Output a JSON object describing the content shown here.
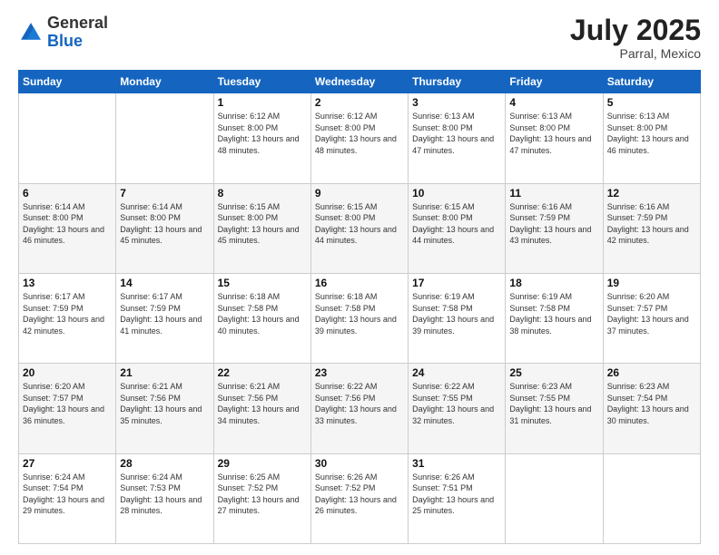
{
  "logo": {
    "general": "General",
    "blue": "Blue"
  },
  "header": {
    "month_year": "July 2025",
    "location": "Parral, Mexico"
  },
  "days_of_week": [
    "Sunday",
    "Monday",
    "Tuesday",
    "Wednesday",
    "Thursday",
    "Friday",
    "Saturday"
  ],
  "weeks": [
    [
      {
        "day": "",
        "sunrise": "",
        "sunset": "",
        "daylight": ""
      },
      {
        "day": "",
        "sunrise": "",
        "sunset": "",
        "daylight": ""
      },
      {
        "day": "1",
        "sunrise": "Sunrise: 6:12 AM",
        "sunset": "Sunset: 8:00 PM",
        "daylight": "Daylight: 13 hours and 48 minutes."
      },
      {
        "day": "2",
        "sunrise": "Sunrise: 6:12 AM",
        "sunset": "Sunset: 8:00 PM",
        "daylight": "Daylight: 13 hours and 48 minutes."
      },
      {
        "day": "3",
        "sunrise": "Sunrise: 6:13 AM",
        "sunset": "Sunset: 8:00 PM",
        "daylight": "Daylight: 13 hours and 47 minutes."
      },
      {
        "day": "4",
        "sunrise": "Sunrise: 6:13 AM",
        "sunset": "Sunset: 8:00 PM",
        "daylight": "Daylight: 13 hours and 47 minutes."
      },
      {
        "day": "5",
        "sunrise": "Sunrise: 6:13 AM",
        "sunset": "Sunset: 8:00 PM",
        "daylight": "Daylight: 13 hours and 46 minutes."
      }
    ],
    [
      {
        "day": "6",
        "sunrise": "Sunrise: 6:14 AM",
        "sunset": "Sunset: 8:00 PM",
        "daylight": "Daylight: 13 hours and 46 minutes."
      },
      {
        "day": "7",
        "sunrise": "Sunrise: 6:14 AM",
        "sunset": "Sunset: 8:00 PM",
        "daylight": "Daylight: 13 hours and 45 minutes."
      },
      {
        "day": "8",
        "sunrise": "Sunrise: 6:15 AM",
        "sunset": "Sunset: 8:00 PM",
        "daylight": "Daylight: 13 hours and 45 minutes."
      },
      {
        "day": "9",
        "sunrise": "Sunrise: 6:15 AM",
        "sunset": "Sunset: 8:00 PM",
        "daylight": "Daylight: 13 hours and 44 minutes."
      },
      {
        "day": "10",
        "sunrise": "Sunrise: 6:15 AM",
        "sunset": "Sunset: 8:00 PM",
        "daylight": "Daylight: 13 hours and 44 minutes."
      },
      {
        "day": "11",
        "sunrise": "Sunrise: 6:16 AM",
        "sunset": "Sunset: 7:59 PM",
        "daylight": "Daylight: 13 hours and 43 minutes."
      },
      {
        "day": "12",
        "sunrise": "Sunrise: 6:16 AM",
        "sunset": "Sunset: 7:59 PM",
        "daylight": "Daylight: 13 hours and 42 minutes."
      }
    ],
    [
      {
        "day": "13",
        "sunrise": "Sunrise: 6:17 AM",
        "sunset": "Sunset: 7:59 PM",
        "daylight": "Daylight: 13 hours and 42 minutes."
      },
      {
        "day": "14",
        "sunrise": "Sunrise: 6:17 AM",
        "sunset": "Sunset: 7:59 PM",
        "daylight": "Daylight: 13 hours and 41 minutes."
      },
      {
        "day": "15",
        "sunrise": "Sunrise: 6:18 AM",
        "sunset": "Sunset: 7:58 PM",
        "daylight": "Daylight: 13 hours and 40 minutes."
      },
      {
        "day": "16",
        "sunrise": "Sunrise: 6:18 AM",
        "sunset": "Sunset: 7:58 PM",
        "daylight": "Daylight: 13 hours and 39 minutes."
      },
      {
        "day": "17",
        "sunrise": "Sunrise: 6:19 AM",
        "sunset": "Sunset: 7:58 PM",
        "daylight": "Daylight: 13 hours and 39 minutes."
      },
      {
        "day": "18",
        "sunrise": "Sunrise: 6:19 AM",
        "sunset": "Sunset: 7:58 PM",
        "daylight": "Daylight: 13 hours and 38 minutes."
      },
      {
        "day": "19",
        "sunrise": "Sunrise: 6:20 AM",
        "sunset": "Sunset: 7:57 PM",
        "daylight": "Daylight: 13 hours and 37 minutes."
      }
    ],
    [
      {
        "day": "20",
        "sunrise": "Sunrise: 6:20 AM",
        "sunset": "Sunset: 7:57 PM",
        "daylight": "Daylight: 13 hours and 36 minutes."
      },
      {
        "day": "21",
        "sunrise": "Sunrise: 6:21 AM",
        "sunset": "Sunset: 7:56 PM",
        "daylight": "Daylight: 13 hours and 35 minutes."
      },
      {
        "day": "22",
        "sunrise": "Sunrise: 6:21 AM",
        "sunset": "Sunset: 7:56 PM",
        "daylight": "Daylight: 13 hours and 34 minutes."
      },
      {
        "day": "23",
        "sunrise": "Sunrise: 6:22 AM",
        "sunset": "Sunset: 7:56 PM",
        "daylight": "Daylight: 13 hours and 33 minutes."
      },
      {
        "day": "24",
        "sunrise": "Sunrise: 6:22 AM",
        "sunset": "Sunset: 7:55 PM",
        "daylight": "Daylight: 13 hours and 32 minutes."
      },
      {
        "day": "25",
        "sunrise": "Sunrise: 6:23 AM",
        "sunset": "Sunset: 7:55 PM",
        "daylight": "Daylight: 13 hours and 31 minutes."
      },
      {
        "day": "26",
        "sunrise": "Sunrise: 6:23 AM",
        "sunset": "Sunset: 7:54 PM",
        "daylight": "Daylight: 13 hours and 30 minutes."
      }
    ],
    [
      {
        "day": "27",
        "sunrise": "Sunrise: 6:24 AM",
        "sunset": "Sunset: 7:54 PM",
        "daylight": "Daylight: 13 hours and 29 minutes."
      },
      {
        "day": "28",
        "sunrise": "Sunrise: 6:24 AM",
        "sunset": "Sunset: 7:53 PM",
        "daylight": "Daylight: 13 hours and 28 minutes."
      },
      {
        "day": "29",
        "sunrise": "Sunrise: 6:25 AM",
        "sunset": "Sunset: 7:52 PM",
        "daylight": "Daylight: 13 hours and 27 minutes."
      },
      {
        "day": "30",
        "sunrise": "Sunrise: 6:26 AM",
        "sunset": "Sunset: 7:52 PM",
        "daylight": "Daylight: 13 hours and 26 minutes."
      },
      {
        "day": "31",
        "sunrise": "Sunrise: 6:26 AM",
        "sunset": "Sunset: 7:51 PM",
        "daylight": "Daylight: 13 hours and 25 minutes."
      },
      {
        "day": "",
        "sunrise": "",
        "sunset": "",
        "daylight": ""
      },
      {
        "day": "",
        "sunrise": "",
        "sunset": "",
        "daylight": ""
      }
    ]
  ]
}
